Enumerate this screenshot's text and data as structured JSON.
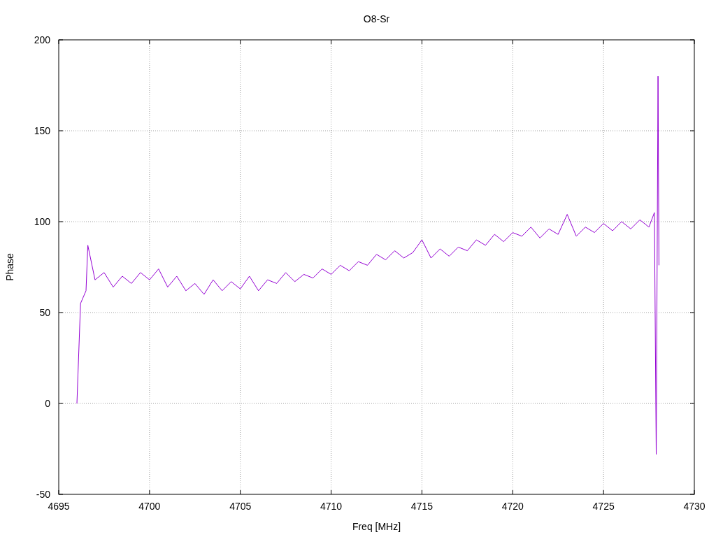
{
  "chart_data": {
    "type": "line",
    "title": "O8-Sr",
    "xlabel": "Freq [MHz]",
    "ylabel": "Phase",
    "x": [
      4696,
      4696.2,
      4696.5,
      4696.6,
      4697,
      4697.5,
      4698,
      4698.5,
      4699,
      4699.5,
      4700,
      4700.5,
      4701,
      4701.5,
      4702,
      4702.5,
      4703,
      4703.5,
      4704,
      4704.5,
      4705,
      4705.5,
      4706,
      4706.5,
      4707,
      4707.5,
      4708,
      4708.5,
      4709,
      4709.5,
      4710,
      4710.5,
      4711,
      4711.5,
      4712,
      4712.5,
      4713,
      4713.5,
      4714,
      4714.5,
      4715,
      4715.5,
      4716,
      4716.5,
      4717,
      4717.5,
      4718,
      4718.5,
      4719,
      4719.5,
      4720,
      4720.5,
      4721,
      4721.5,
      4722,
      4722.5,
      4723,
      4723.5,
      4724,
      4724.5,
      4725,
      4725.5,
      4726,
      4726.5,
      4727,
      4727.5,
      4727.8,
      4727.9,
      4728,
      4728.05
    ],
    "series": [
      {
        "color": "#9400d3",
        "values": [
          0,
          55,
          62,
          87,
          68,
          72,
          64,
          70,
          66,
          72,
          68,
          74,
          64,
          70,
          62,
          66,
          60,
          68,
          62,
          67,
          63,
          70,
          62,
          68,
          66,
          72,
          67,
          71,
          69,
          74,
          71,
          76,
          73,
          78,
          76,
          82,
          79,
          84,
          80,
          83,
          90,
          80,
          85,
          81,
          86,
          84,
          90,
          87,
          93,
          89,
          94,
          92,
          97,
          91,
          96,
          93,
          104,
          92,
          97,
          94,
          99,
          95,
          100,
          96,
          101,
          97,
          105,
          -28,
          180,
          76
        ]
      }
    ],
    "xlim": [
      4695,
      4730
    ],
    "ylim": [
      -50,
      200
    ],
    "xticks": [
      4695,
      4700,
      4705,
      4710,
      4715,
      4720,
      4725,
      4730
    ],
    "yticks": [
      -50,
      0,
      50,
      100,
      150,
      200
    ],
    "grid": true
  }
}
